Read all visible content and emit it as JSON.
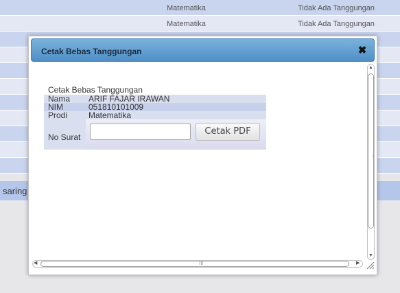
{
  "background_table": {
    "rows": [
      {
        "prodi": "Matematika",
        "status": "Tidak Ada Tanggungan"
      },
      {
        "prodi": "Matematika",
        "status": "Tidak Ada Tanggungan"
      }
    ]
  },
  "filter": {
    "label": "saring"
  },
  "dialog": {
    "title": "Cetak Bebas Tanggungan",
    "close_icon": "close-icon",
    "form": {
      "caption": "Cetak Bebas Tanggungan",
      "fields": [
        {
          "label": "Nama",
          "value": "ARIF FAJAR IRAWAN"
        },
        {
          "label": "NIM",
          "value": "051810101009"
        },
        {
          "label": "Prodi",
          "value": "Matematika"
        }
      ],
      "no_surat": {
        "label": "No Surat",
        "value": "",
        "placeholder": ""
      },
      "print_button_label": "Cetak PDF"
    }
  },
  "scrollbar": {
    "vertical_grip": "⋮",
    "horizontal_grip": "III"
  }
}
